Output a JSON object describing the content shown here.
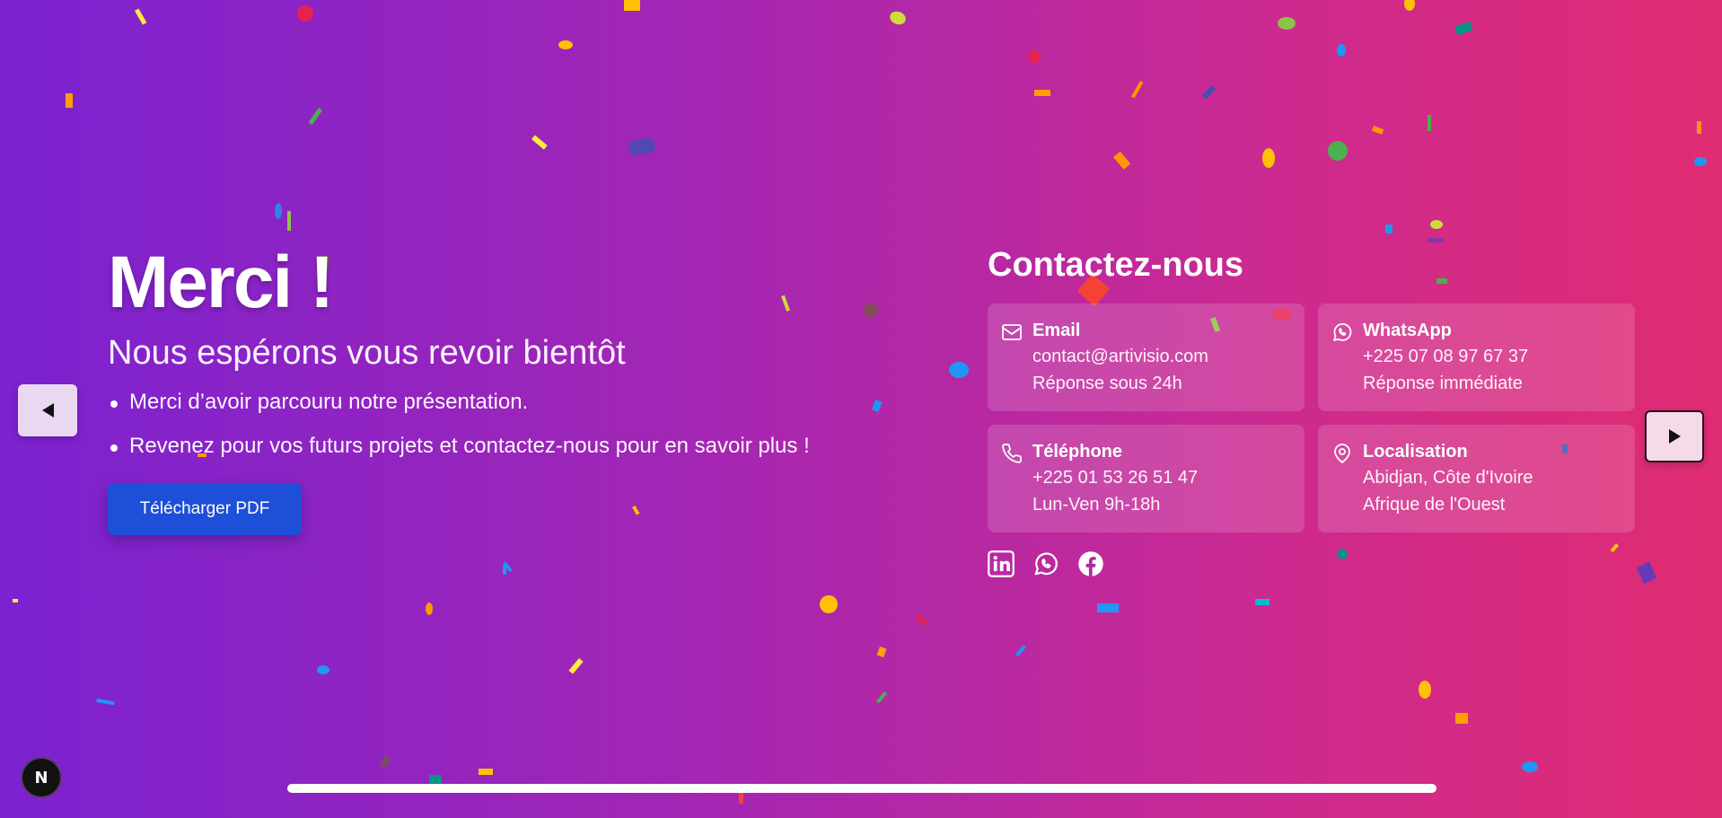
{
  "slide": {
    "title": "Merci !",
    "subtitle": "Nous espérons vous revoir bientôt",
    "bullets": [
      "Merci d’avoir parcouru notre présentation.",
      "Revenez pour vos futurs projets et contactez-nous pour en savoir plus !"
    ],
    "download_button": "Télécharger PDF"
  },
  "contact": {
    "title": "Contactez-nous",
    "cards": [
      {
        "icon": "mail-icon",
        "title": "Email",
        "line1": "contact@artivisio.com",
        "line2": "Réponse sous 24h"
      },
      {
        "icon": "whatsapp-icon",
        "title": "WhatsApp",
        "line1": "+225 07 08 97 67 37",
        "line2": "Réponse immédiate"
      },
      {
        "icon": "phone-icon",
        "title": "Téléphone",
        "line1": "+225 01 53 26 51 47",
        "line2": "Lun-Ven 9h-18h"
      },
      {
        "icon": "map-pin-icon",
        "title": "Localisation",
        "line1": "Abidjan, Côte d'Ivoire",
        "line2": "Afrique de l'Ouest"
      }
    ],
    "socials": [
      "linkedin-icon",
      "whatsapp-icon",
      "facebook-icon"
    ]
  },
  "navigation": {
    "prev_icon": "triangle-left-icon",
    "next_icon": "triangle-right-icon"
  },
  "badge": {
    "label": "N"
  },
  "colors": {
    "gradient_start": "#7b22d1",
    "gradient_end": "#e02c72",
    "button": "#1e4fd8"
  }
}
